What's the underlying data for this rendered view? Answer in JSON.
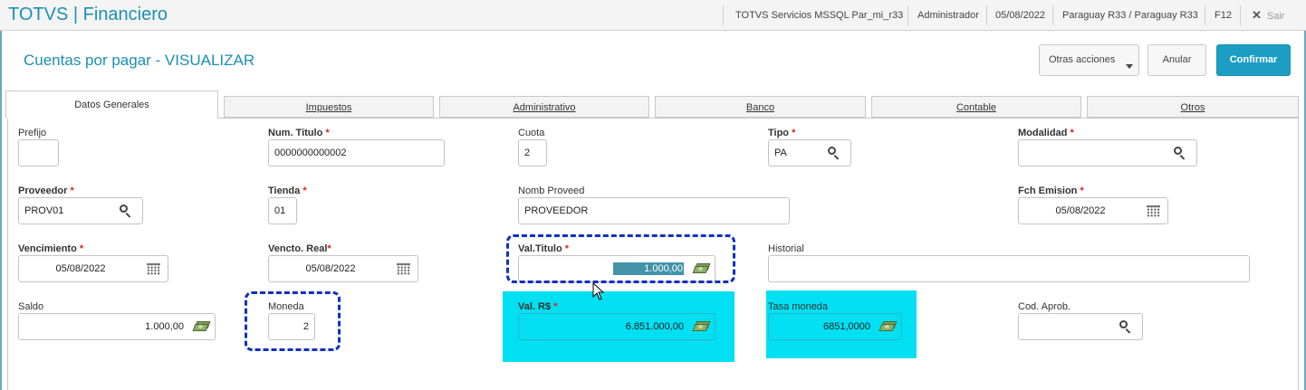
{
  "app": {
    "brand": "TOTVS | Financiero",
    "environment": "TOTVS Servicios MSSQL Par_mi_r33",
    "user": "Administrador",
    "date": "05/08/2022",
    "branch": "Paraguay R33 / Paraguay R33",
    "help_key": "F12",
    "exit_label": "Sair"
  },
  "page": {
    "title": "Cuentas por pagar - VISUALIZAR"
  },
  "actions": {
    "other": "Otras acciones",
    "cancel": "Anular",
    "confirm": "Confirmar"
  },
  "tabs": [
    "Datos Generales",
    "Impuestos",
    "Administrativo",
    "Banco",
    "Contable",
    "Otros"
  ],
  "required_mark": "*",
  "fields": {
    "prefijo": {
      "label": "Prefijo",
      "value": ""
    },
    "num_titulo": {
      "label": "Num. Titulo",
      "value": "0000000000002"
    },
    "cuota": {
      "label": "Cuota",
      "value": "2"
    },
    "tipo": {
      "label": "Tipo",
      "value": "PA"
    },
    "modalidad": {
      "label": "Modalidad",
      "value": ""
    },
    "proveedor": {
      "label": "Proveedor",
      "value": "PROV01"
    },
    "tienda": {
      "label": "Tienda",
      "value": "01"
    },
    "nomb_proveed": {
      "label": "Nomb Proveed",
      "value": "PROVEEDOR"
    },
    "fch_emision": {
      "label": "Fch Emision",
      "value": "05/08/2022"
    },
    "vencimiento": {
      "label": "Vencimiento",
      "value": "05/08/2022"
    },
    "vencto_real": {
      "label": "Vencto. Real",
      "value": "05/08/2022"
    },
    "val_titulo": {
      "label": "Val.Titulo",
      "value": "1.000,00"
    },
    "historial": {
      "label": "Historial",
      "value": ""
    },
    "saldo": {
      "label": "Saldo",
      "value": "1.000,00"
    },
    "moneda": {
      "label": "Moneda",
      "value": "2"
    },
    "val_rs": {
      "label": "Val. R$",
      "value": "6.851.000,00"
    },
    "tasa_moneda": {
      "label": "Tasa moneda",
      "value": "6851,0000"
    },
    "cod_aprob": {
      "label": "Cod. Aprob.",
      "value": ""
    }
  },
  "colors": {
    "brand": "#1b8fb3",
    "confirm": "#1c9dc4",
    "annotation_dash": "#1030c0",
    "annotation_fill": "#00e0f2",
    "required": "#d9261c"
  }
}
